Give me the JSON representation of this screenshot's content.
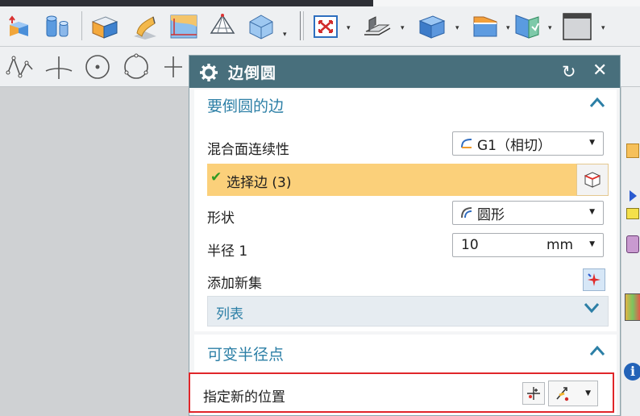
{
  "dialog": {
    "title": "边倒圆",
    "section_edges": {
      "header": "要倒圆的边",
      "blend_continuity_label": "混合面连续性",
      "blend_continuity_value": "G1（相切）",
      "select_edges_label": "选择边 (3)",
      "shape_label": "形状",
      "shape_value": "圆形",
      "radius_label": "半径 1",
      "radius_value": "10",
      "radius_unit": "mm",
      "add_new_set_label": "添加新集",
      "list_label": "列表"
    },
    "section_variable": {
      "header": "可变半径点",
      "specify_position_label": "指定新的位置"
    }
  },
  "colors": {
    "title_bar": "#486f7c",
    "section_header": "#2c7fa6",
    "selection_highlight": "#fbd07a",
    "annotation_box": "#e0262a"
  },
  "icons": {
    "toolbar": [
      "extrude-icon",
      "cylinder-icon",
      "block-icon",
      "sweep-icon",
      "face-icon",
      "surface-icon",
      "shell-icon",
      "fit-view-icon",
      "shading-icon",
      "solid-icon",
      "section-icon",
      "visibility-icon",
      "color-icon"
    ],
    "sketch": [
      "studio-spline-icon",
      "point-on-curve-icon",
      "circle-icon",
      "circle-by-points-icon",
      "plus-icon"
    ]
  }
}
